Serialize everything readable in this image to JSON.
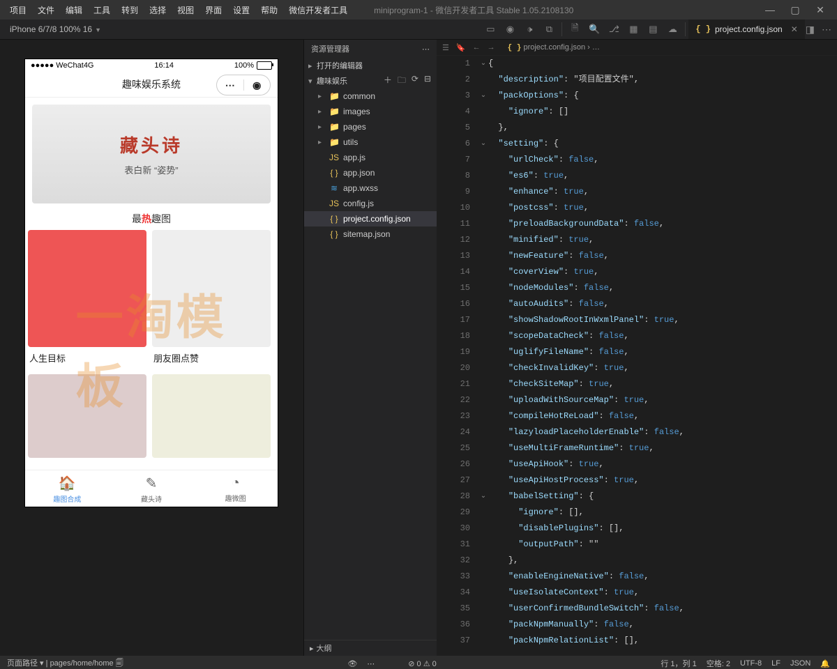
{
  "menu": {
    "items": [
      "项目",
      "文件",
      "编辑",
      "工具",
      "转到",
      "选择",
      "视图",
      "界面",
      "设置",
      "帮助",
      "微信开发者工具"
    ],
    "title": "miniprogram-1 - 微信开发者工具 Stable 1.05.2108130"
  },
  "toolbar": {
    "device": "iPhone 6/7/8 100% 16"
  },
  "tab": {
    "file": "project.config.json"
  },
  "breadcrumb": {
    "file": "project.config.json",
    "more": "…"
  },
  "explorer": {
    "title": "资源管理器",
    "open_editors": "打开的编辑器",
    "root": "趣味娱乐",
    "nodes": [
      {
        "name": "common",
        "type": "folder",
        "color": "folder-ico"
      },
      {
        "name": "images",
        "type": "folder",
        "color": "folder-green"
      },
      {
        "name": "pages",
        "type": "folder",
        "color": "folder-red"
      },
      {
        "name": "utils",
        "type": "folder",
        "color": "folder-green"
      },
      {
        "name": "app.js",
        "type": "js"
      },
      {
        "name": "app.json",
        "type": "json"
      },
      {
        "name": "app.wxss",
        "type": "wxss"
      },
      {
        "name": "config.js",
        "type": "js"
      },
      {
        "name": "project.config.json",
        "type": "json",
        "sel": true
      },
      {
        "name": "sitemap.json",
        "type": "json"
      }
    ],
    "outline": "大纲"
  },
  "sim": {
    "carrier": "WeChat4G",
    "time": "16:14",
    "batt": "100%",
    "title": "趣味娱乐系统",
    "banner_big": "藏头诗",
    "banner_sub": "表白新 “姿势”",
    "hot_prefix": "最",
    "hot_mid": "热",
    "hot_suffix": "趣图",
    "cards": [
      "人生目标",
      "朋友圈点赞"
    ],
    "tabs": [
      "趣图合成",
      "藏头诗",
      "趣微图"
    ]
  },
  "code": [
    "{",
    "  \"description\": \"项目配置文件\",",
    "  \"packOptions\": {",
    "    \"ignore\": []",
    "  },",
    "  \"setting\": {",
    "    \"urlCheck\": false,",
    "    \"es6\": true,",
    "    \"enhance\": true,",
    "    \"postcss\": true,",
    "    \"preloadBackgroundData\": false,",
    "    \"minified\": true,",
    "    \"newFeature\": false,",
    "    \"coverView\": true,",
    "    \"nodeModules\": false,",
    "    \"autoAudits\": false,",
    "    \"showShadowRootInWxmlPanel\": true,",
    "    \"scopeDataCheck\": false,",
    "    \"uglifyFileName\": false,",
    "    \"checkInvalidKey\": true,",
    "    \"checkSiteMap\": true,",
    "    \"uploadWithSourceMap\": true,",
    "    \"compileHotReLoad\": false,",
    "    \"lazyloadPlaceholderEnable\": false,",
    "    \"useMultiFrameRuntime\": true,",
    "    \"useApiHook\": true,",
    "    \"useApiHostProcess\": true,",
    "    \"babelSetting\": {",
    "      \"ignore\": [],",
    "      \"disablePlugins\": [],",
    "      \"outputPath\": \"\"",
    "    },",
    "    \"enableEngineNative\": false,",
    "    \"useIsolateContext\": true,",
    "    \"userConfirmedBundleSwitch\": false,",
    "    \"packNpmManually\": false,",
    "    \"packNpmRelationList\": [],"
  ],
  "status": {
    "path_label": "页面路径",
    "path": "pages/home/home",
    "err": "⊘ 0 ⚠ 0",
    "pos": "行 1，列 1",
    "spaces": "空格: 2",
    "enc": "UTF-8",
    "eol": "LF",
    "lang": "JSON"
  },
  "watermark": "一淘模板"
}
